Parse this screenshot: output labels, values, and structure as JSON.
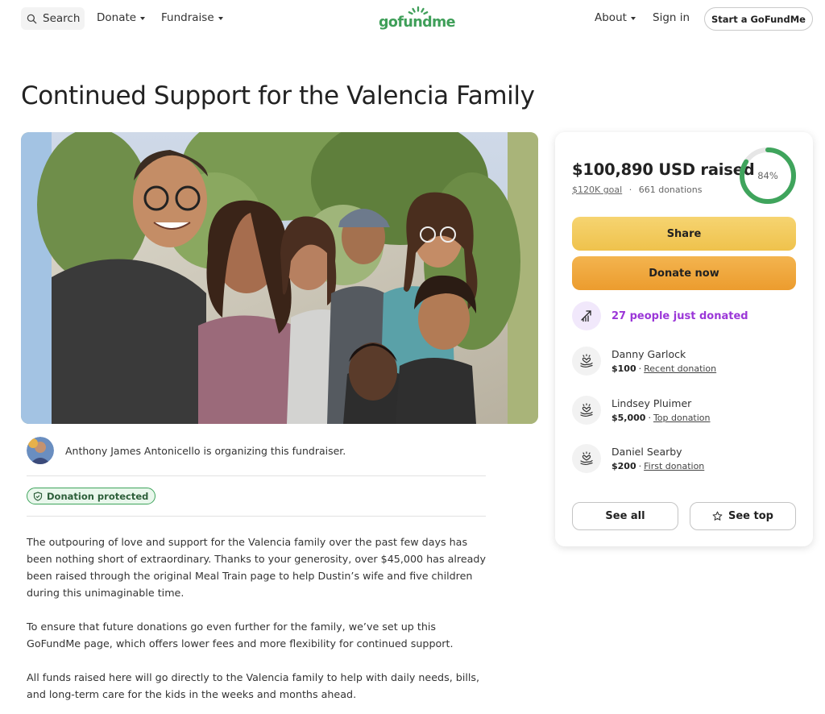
{
  "header": {
    "search_label": "Search",
    "nav_left": [
      {
        "label": "Donate"
      },
      {
        "label": "Fundraise"
      }
    ],
    "logo_text": "gofundme",
    "nav_right": [
      {
        "label": "About"
      },
      {
        "label": "Sign in"
      }
    ],
    "cta_label": "Start a GoFundMe"
  },
  "campaign": {
    "title": "Continued Support for the Valencia Family",
    "organizer_text": "Anthony James Antonicello is organizing this fundraiser.",
    "protected_label": "Donation protected",
    "story": [
      "The outpouring of love and support for the Valencia family over the past few days has been nothing short of extraordinary. Thanks to your generosity, over $45,000 has already been raised through the original Meal Train page to help Dustin’s wife and five children during this unimaginable time.",
      "To ensure that future donations go even further for the family, we’ve set up this GoFundMe page, which offers lower fees and more flexibility for continued support.",
      "All funds raised here will go directly to the Valencia family to help with daily needs, bills, and long-term care for the kids in the weeks and months ahead."
    ]
  },
  "donation_card": {
    "raised_text": "$100,890 USD raised",
    "goal_text": "$120K goal",
    "separator": "·",
    "donations_text": "661 donations",
    "progress_percent_label": "84%",
    "progress_fraction": 0.84,
    "share_label": "Share",
    "donate_label": "Donate now",
    "trend_text": "27 people just donated",
    "donors": [
      {
        "name": "Danny Garlock",
        "amount": "$100",
        "tag": "Recent donation"
      },
      {
        "name": "Lindsey Pluimer",
        "amount": "$5,000",
        "tag": "Top donation"
      },
      {
        "name": "Daniel Searby",
        "amount": "$200",
        "tag": "First donation"
      }
    ],
    "see_all_label": "See all",
    "see_top_label": "See top"
  },
  "colors": {
    "brand_green": "#3f9f59",
    "share_yellow": "#efc24c",
    "donate_orange": "#ec9c2e",
    "trend_purple": "#9b37d8",
    "protected_green": "#3fa45c"
  },
  "icons": {
    "search": "search-icon",
    "shield": "shield-icon",
    "trend": "trending-up-icon",
    "donor": "heart-hand-icon",
    "star": "star-icon"
  }
}
